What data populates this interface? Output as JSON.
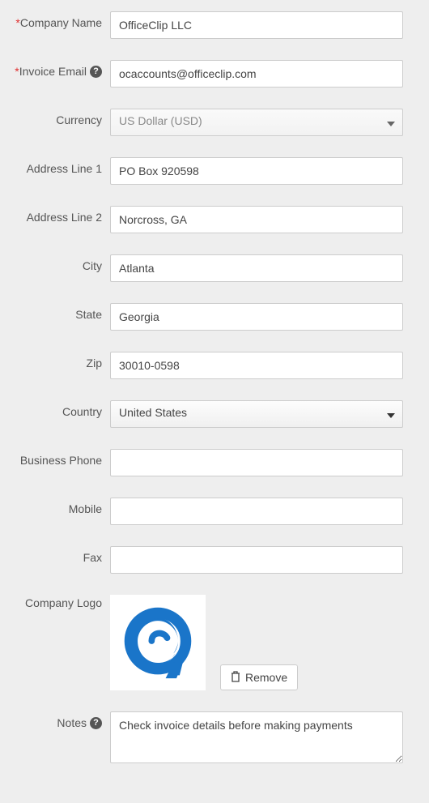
{
  "labels": {
    "company_name": "Company Name",
    "invoice_email": "Invoice Email",
    "currency": "Currency",
    "address1": "Address Line 1",
    "address2": "Address Line 2",
    "city": "City",
    "state": "State",
    "zip": "Zip",
    "country": "Country",
    "business_phone": "Business Phone",
    "mobile": "Mobile",
    "fax": "Fax",
    "company_logo": "Company Logo",
    "notes": "Notes"
  },
  "values": {
    "company_name": "OfficeClip LLC",
    "invoice_email": "ocaccounts@officeclip.com",
    "currency": "US Dollar (USD)",
    "address1": "PO Box 920598",
    "address2": "Norcross, GA",
    "city": "Atlanta",
    "state": "Georgia",
    "zip": "30010-0598",
    "country": "United States",
    "business_phone": "",
    "mobile": "",
    "fax": "",
    "notes": "Check invoice details before making payments"
  },
  "buttons": {
    "remove": "Remove"
  },
  "required_marker": "*"
}
